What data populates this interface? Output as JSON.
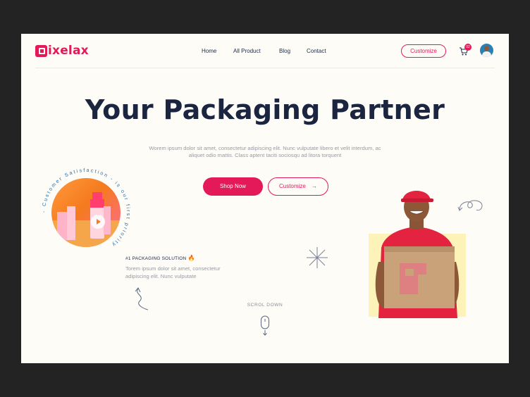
{
  "brand": {
    "logo_text": "ixelax",
    "logo_letter": "P",
    "accent": "#e3195a"
  },
  "nav": {
    "items": [
      "Home",
      "All Product",
      "Blog",
      "Contact"
    ]
  },
  "header": {
    "customize_label": "Customize",
    "cart_count": "02"
  },
  "hero": {
    "title": "Your Packaging Partner",
    "subtitle": "Worem ipsum dolor sit amet, consectetur adipiscing elit. Nunc vulputate libero et velit interdum, ac aliquet odio mattis. Class aptent taciti sociosqu ad litora torquent",
    "shop_label": "Shop Now",
    "customize_label": "Customize"
  },
  "badge_circle": {
    "ring_text": "- Customer Satisfaction - is our first priority "
  },
  "solution": {
    "tag": "#1 PACKAGING SOLUTION",
    "desc": "Torem ipsum dolor sit amet, consectetur adipiscing elit. Nunc vulputate"
  },
  "scroll": {
    "label": "SCROL DOWN"
  },
  "colors": {
    "title": "#1b2540",
    "page_bg": "#fdfcf7",
    "outer_bg": "#232323",
    "photo_bg": "#fdf3b8"
  }
}
